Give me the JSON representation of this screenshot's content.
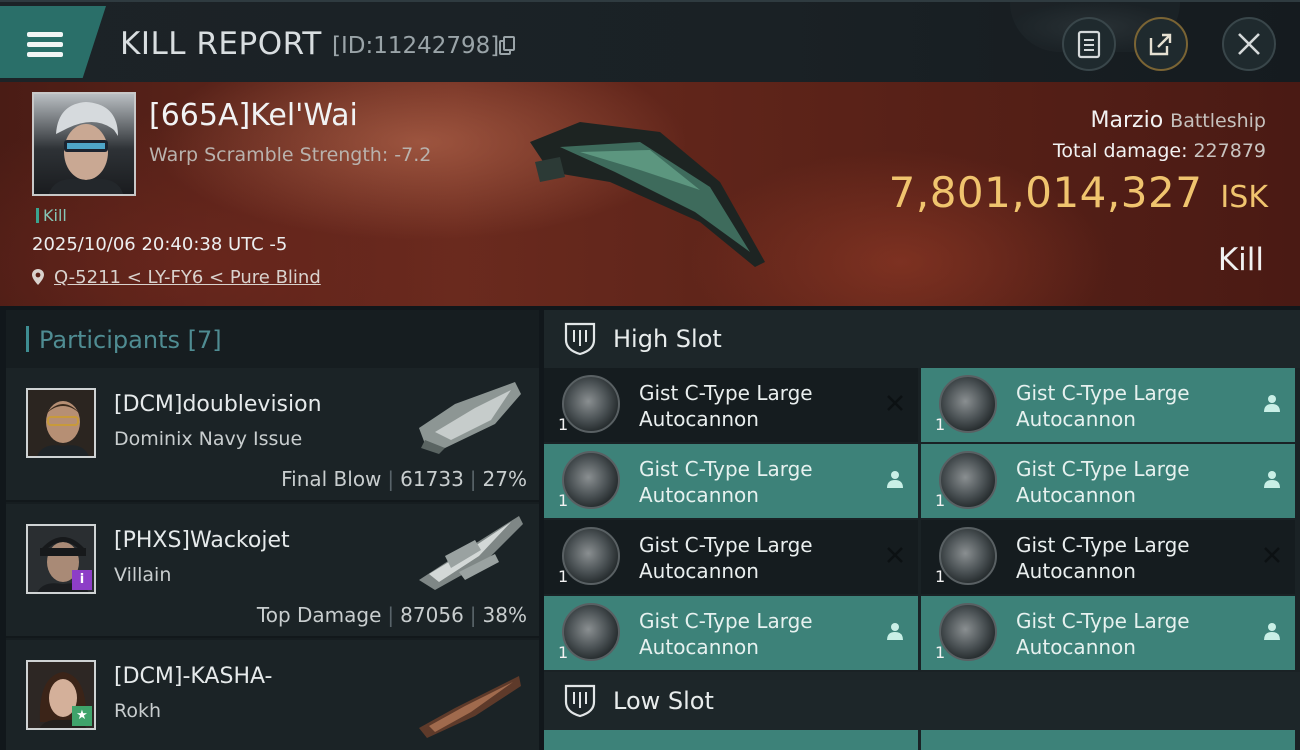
{
  "header": {
    "title": "KILL REPORT",
    "report_id": "[ID:11242798]"
  },
  "victim": {
    "name": "[665A]Kel'Wai",
    "scramble": "Warp Scramble Strength: -7.2",
    "tag": "Kill",
    "datetime": "2025/10/06 20:40:38 UTC -5",
    "location": "Q-5211 < LY-FY6 < Pure Blind",
    "ship_name": "Marzio",
    "ship_class": "Battleship",
    "damage_label": "Total damage:",
    "damage_value": "227879",
    "isk_amount": "7,801,014,327",
    "isk_currency": "ISK",
    "result": "Kill"
  },
  "participants": {
    "title": "Participants [7]",
    "list": [
      {
        "name": "[DCM]doublevision",
        "ship": "Dominix Navy Issue",
        "role": "Final Blow",
        "damage": "61733",
        "percent": "27%"
      },
      {
        "name": "[PHXS]Wackojet",
        "ship": "Villain",
        "role": "Top Damage",
        "damage": "87056",
        "percent": "38%"
      },
      {
        "name": "[DCM]-KASHA-",
        "ship": "Rokh"
      }
    ]
  },
  "slots": {
    "high_label": "High Slot",
    "low_label": "Low Slot",
    "items": [
      {
        "line1": "Gist C-Type Large",
        "line2": "Autocannon",
        "qty": "1",
        "status": "destroyed"
      },
      {
        "line1": "Gist C-Type Large",
        "line2": "Autocannon",
        "qty": "1",
        "status": "dropped"
      },
      {
        "line1": "Gist C-Type Large",
        "line2": "Autocannon",
        "qty": "1",
        "status": "dropped"
      },
      {
        "line1": "Gist C-Type Large",
        "line2": "Autocannon",
        "qty": "1",
        "status": "dropped"
      },
      {
        "line1": "Gist C-Type Large",
        "line2": "Autocannon",
        "qty": "1",
        "status": "destroyed"
      },
      {
        "line1": "Gist C-Type Large",
        "line2": "Autocannon",
        "qty": "1",
        "status": "destroyed"
      },
      {
        "line1": "Gist C-Type Large",
        "line2": "Autocannon",
        "qty": "1",
        "status": "dropped"
      },
      {
        "line1": "Gist C-Type Large",
        "line2": "Autocannon",
        "qty": "1",
        "status": "dropped"
      }
    ]
  },
  "colors": {
    "accent_teal": "#3d8279",
    "isk_gold": "#f0c46e",
    "banner_red": "#6a2a1e"
  },
  "icons": [
    "menu-icon",
    "copy-icon",
    "clipboard-icon",
    "share-icon",
    "close-icon",
    "location-pin-icon",
    "shield-slot-icon",
    "autocannon-icon",
    "destroyed-x-icon",
    "dropped-person-icon"
  ]
}
